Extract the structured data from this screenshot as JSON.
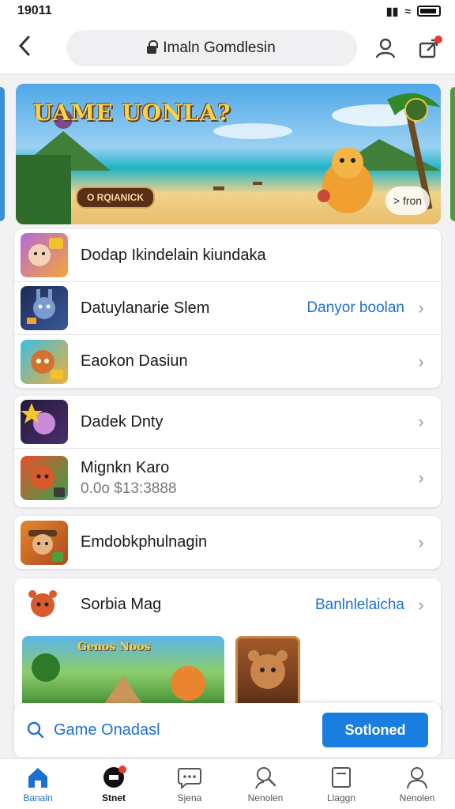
{
  "status_bar": {
    "time": "19011"
  },
  "address_bar": {
    "title": "Imaln Gomdlesin"
  },
  "hero": {
    "title": "UAME UONLA?",
    "tag": "O RQIANICK",
    "next_label": "> fron"
  },
  "group1": [
    {
      "title": "Dodap Ikindelain kiundaka",
      "action": ""
    },
    {
      "title": "Datuylanarie Slem",
      "action": "Danyor boolan"
    },
    {
      "title": "Eaokon Dasiun",
      "action": ""
    }
  ],
  "group2": [
    {
      "title": "Dadek Dnty",
      "subtitle": ""
    },
    {
      "title": "Mignkn Karo",
      "subtitle": "0.0o $13:3888"
    }
  ],
  "group3": [
    {
      "title": "Emdobkphulnagin"
    }
  ],
  "group4": {
    "title": "Sorbia Mag",
    "action": "Banlnlelaicha",
    "strip_title": "Genos Noos"
  },
  "search": {
    "placeholder": "Game Onadasl",
    "button_label": "Sotloned"
  },
  "bottom_nav": [
    {
      "label": "Banaln",
      "icon": "home-icon"
    },
    {
      "label": "Stnet",
      "icon": "badge-icon"
    },
    {
      "label": "Sjena",
      "icon": "chat-icon"
    },
    {
      "label": "Nenolen",
      "icon": "search-person-icon"
    },
    {
      "label": "Llaggn",
      "icon": "document-icon"
    },
    {
      "label": "Nenolen",
      "icon": "profile-icon"
    }
  ],
  "colors": {
    "accent": "#1a7ee0",
    "link": "#1e6fd1",
    "nav_active": "#1a6fd0",
    "badge": "#e53935"
  }
}
